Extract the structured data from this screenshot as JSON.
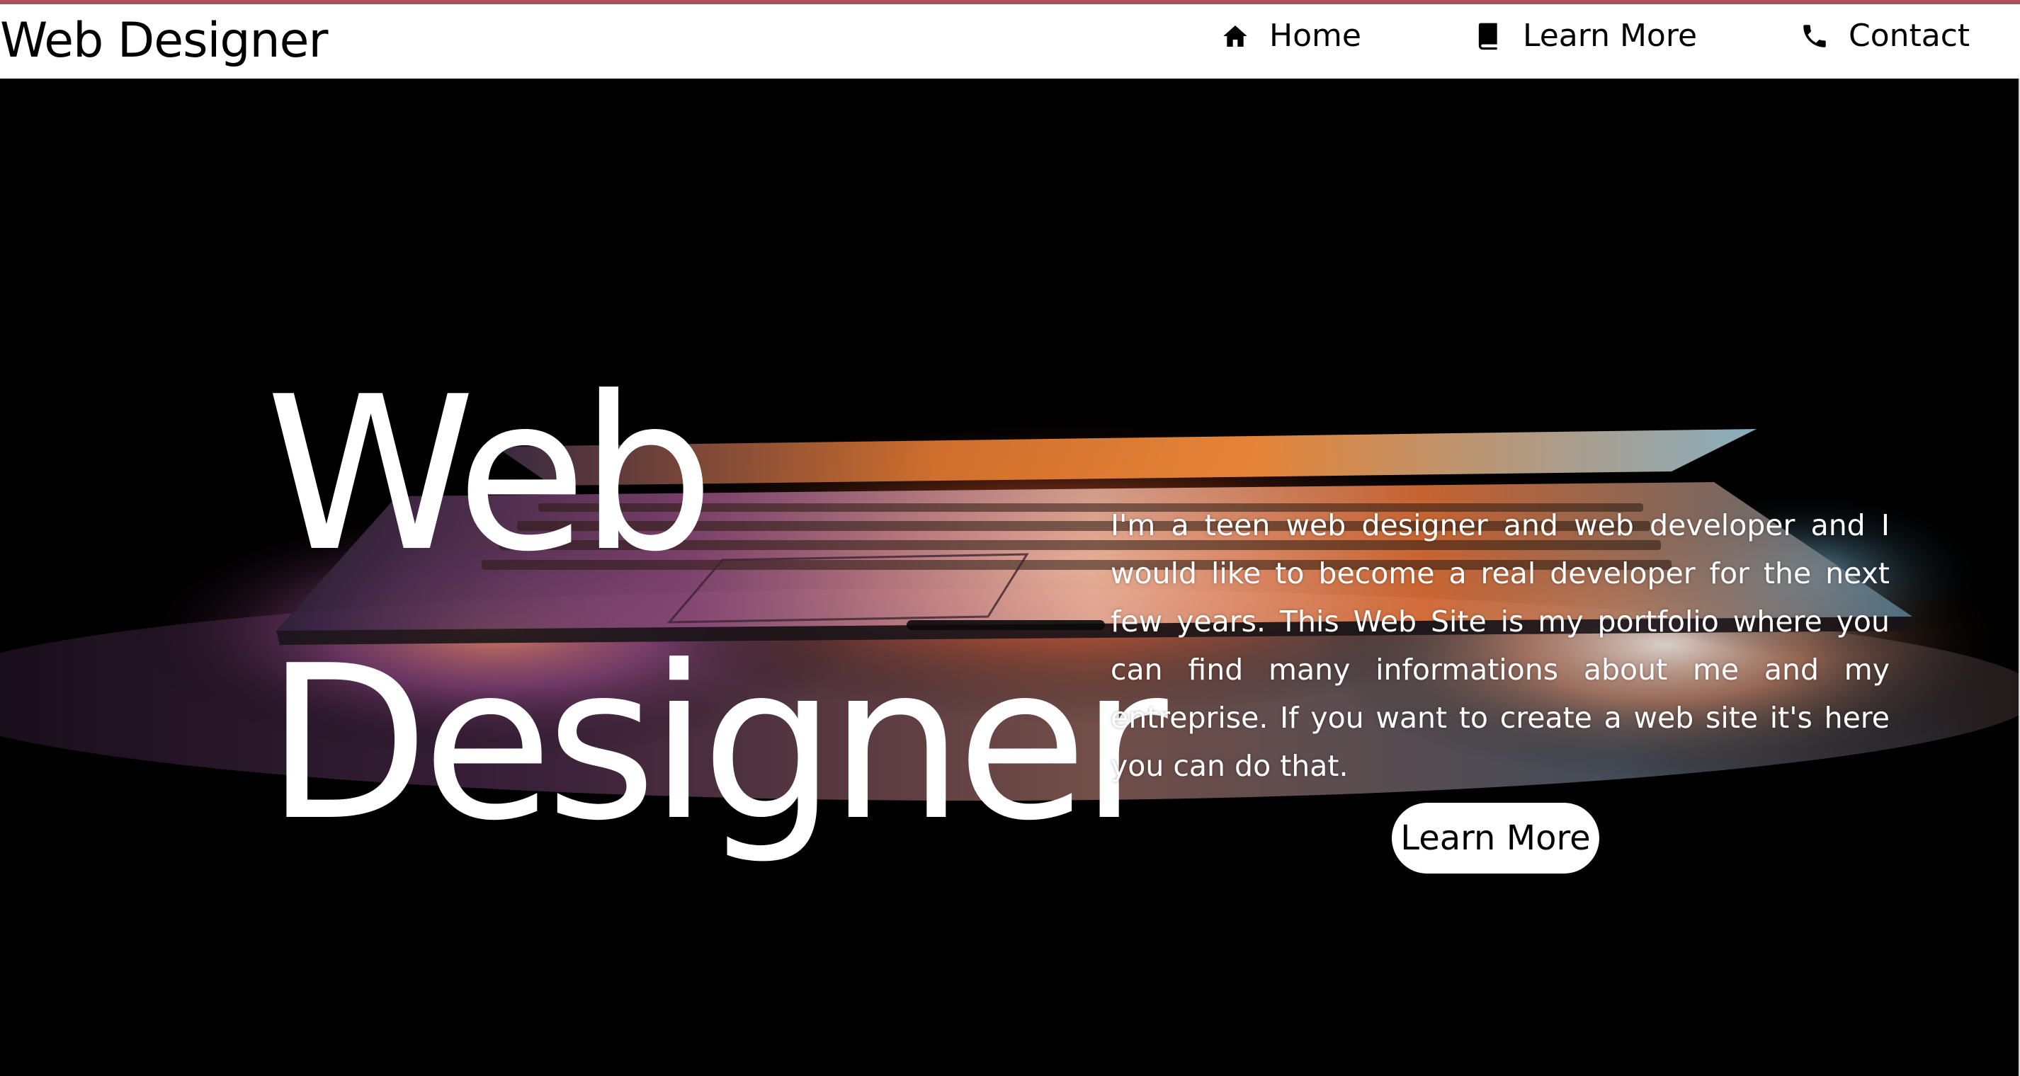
{
  "brand": {
    "title": "Web Designer"
  },
  "nav": {
    "items": [
      {
        "label": "Home",
        "icon": "home-icon"
      },
      {
        "label": "Learn More",
        "icon": "book-icon"
      },
      {
        "label": "Contact",
        "icon": "phone-icon"
      }
    ]
  },
  "hero": {
    "title_line1": "Web",
    "title_line2": "Designer",
    "description": "I'm a teen web designer and web developer and I would like to become a real developer for the next few years. This Web Site is my portfolio where you can find many informations about me and my entreprise. If you want to create a web site it's here you can do that.",
    "cta_label": "Learn More",
    "background_image": "laptop-glow-image"
  },
  "colors": {
    "top_rule": "#a7525a",
    "header_bg": "#ffffff",
    "hero_bg": "#000000",
    "hero_text": "#ffffff",
    "button_bg": "#ffffff",
    "button_text": "#000000"
  }
}
